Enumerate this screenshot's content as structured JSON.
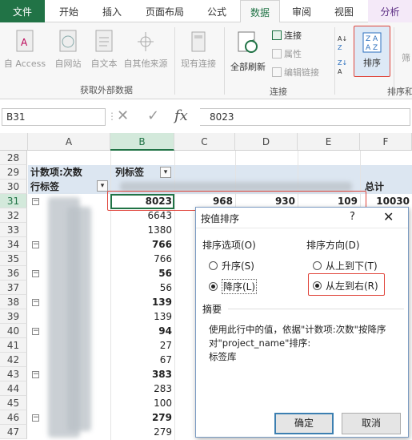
{
  "ribbon_tabs": [
    "文件",
    "开始",
    "插入",
    "页面布局",
    "公式",
    "数据",
    "审阅",
    "视图",
    "分析"
  ],
  "ribbon": {
    "external_group": {
      "buttons": [
        "自 Access",
        "自网站",
        "自文本",
        "自其他来源",
        "现有连接"
      ],
      "label": "获取外部数据"
    },
    "connections_group": {
      "refresh_all": "全部刷新",
      "connections": "连接",
      "properties": "属性",
      "edit_links": "编辑链接",
      "label": "连接"
    },
    "sort_group": {
      "sort_button": "排序",
      "label": "排序和",
      "filter_partial": "筛"
    }
  },
  "formula_bar": {
    "name_box": "B31",
    "cancel_icon": "✕",
    "enter_icon": "✓",
    "fx": "fx",
    "value": "8023"
  },
  "columns": [
    "A",
    "B",
    "C",
    "D",
    "E",
    "F"
  ],
  "row_numbers": [
    "28",
    "29",
    "30",
    "31",
    "32",
    "33",
    "34",
    "35",
    "36",
    "37",
    "38",
    "39",
    "40",
    "41",
    "42",
    "43",
    "44",
    "45",
    "46",
    "47"
  ],
  "pivot": {
    "count_label": "计数项:次数",
    "col_labels": "列标签",
    "row_labels": "行标签",
    "total": "总计",
    "row31": [
      "8023",
      "968",
      "930",
      "109",
      "10030"
    ],
    "b_values": [
      "6643",
      "1380",
      "766",
      "766",
      "56",
      "56",
      "139",
      "139",
      "94",
      "27",
      "67",
      "383",
      "283",
      "100",
      "279",
      "279"
    ]
  },
  "dialog": {
    "title": "按值排序",
    "help": "?",
    "close": "✕",
    "sort_options_label": "排序选项(O)",
    "sort_direction_label": "排序方向(D)",
    "asc": "升序(S)",
    "desc": "降序(L)",
    "top_to_bottom": "从上到下(T)",
    "left_to_right": "从左到右(R)",
    "summary_label": "摘要",
    "summary_text": "使用此行中的值，依据\"计数项:次数\"按降序对\"project_name\"排序:",
    "summary_sub": "标签库",
    "ok": "确定",
    "cancel": "取消"
  },
  "colors": {
    "excel_green": "#217346",
    "highlight_red": "#e0453b",
    "header_blue": "#dce6f1"
  }
}
